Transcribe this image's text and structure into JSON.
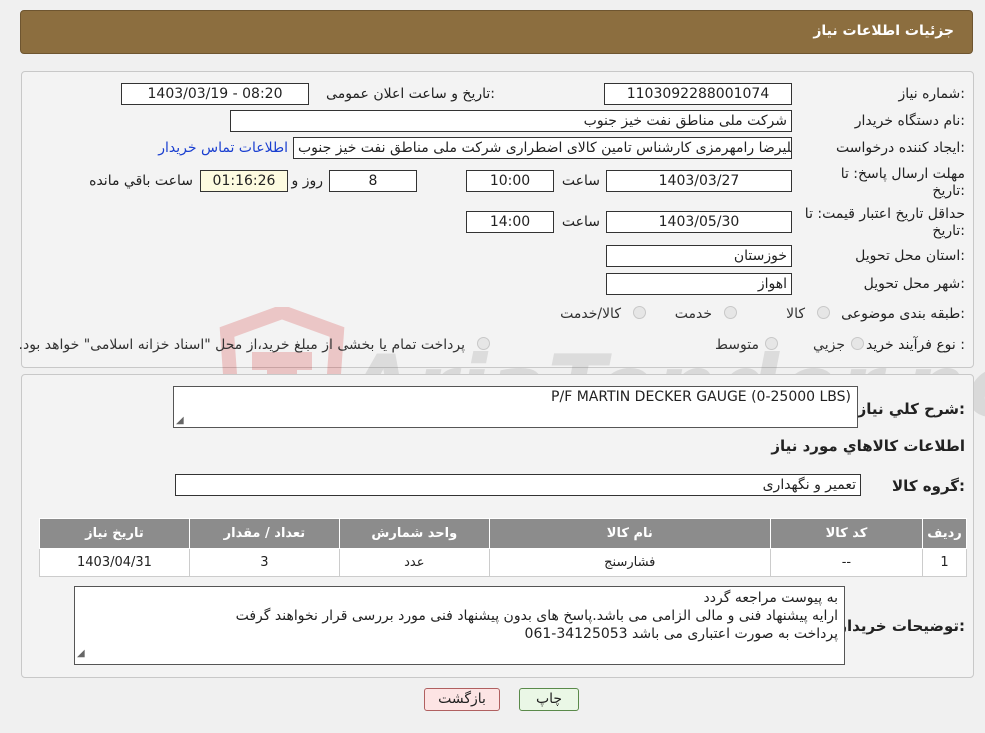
{
  "header": {
    "title": "جزئیات اطلاعات نیاز"
  },
  "form": {
    "need_number_label": "شماره نیاز:",
    "need_number": "1103092288001074",
    "announce_label": "تاریخ و ساعت اعلان عمومی:",
    "announce_value": "1403/03/19 - 08:20",
    "buyer_org_label": "نام دستگاه خریدار:",
    "buyer_org": "شرکت ملی مناطق نفت خیز جنوب",
    "creator_label": "ایجاد کننده درخواست:",
    "creator": "علیرضا رامهرمزی کارشناس تامین کالای اضطراری شرکت ملی مناطق نفت خیز جنوب",
    "contact_link": "اطلاعات تماس خریدار",
    "deadline_label_1": "مهلت ارسال پاسخ: تا",
    "deadline_label_2": "تاریخ:",
    "deadline_date": "1403/03/27",
    "time_label": "ساعت",
    "deadline_time": "10:00",
    "days_value": "8",
    "days_label": "روز و",
    "remaining_time": "01:16:26",
    "remaining_label": "ساعت باقي مانده",
    "validity_label_1": "حداقل تاریخ اعتبار قیمت: تا",
    "validity_label_2": "تاریخ:",
    "validity_date": "1403/05/30",
    "validity_time": "14:00",
    "province_label": "استان محل تحویل:",
    "province": "خوزستان",
    "city_label": "شهر محل تحویل:",
    "city": "اهواز",
    "category_label": "طبقه بندی موضوعی:",
    "category_options": [
      "کالا",
      "خدمت",
      "کالا/خدمت"
    ],
    "process_label": "نوع فرآیند خرید :",
    "process_options": [
      "جزیي",
      "متوسط"
    ],
    "process_note": "پرداخت تمام یا بخشی از مبلغ خرید،از محل \"اسناد خزانه اسلامی\" خواهد بود."
  },
  "details": {
    "summary_label": "شرح كلي نياز:",
    "summary": "P/F MARTIN DECKER GAUGE (0-25000 LBS)",
    "goods_info_title": "اطلاعات کالاهاي مورد نياز",
    "goods_group_label": "گروه کالا:",
    "goods_group": "تعمیر و نگهداری",
    "table": {
      "headers": [
        "ردیف",
        "کد کالا",
        "نام کالا",
        "واحد شمارش",
        "تعداد / مقدار",
        "تاریخ نیاز"
      ],
      "rows": [
        [
          "1",
          "--",
          "فشارسنج",
          "عدد",
          "3",
          "1403/04/31"
        ]
      ]
    },
    "buyer_notes_label": "توضیحات خریدار:",
    "buyer_notes": [
      "به پیوست مراجعه گردد",
      "ارایه پیشنهاد فنی و مالی الزامی می باشد.پاسخ های بدون پیشنهاد فنی مورد بررسی قرار نخواهند گرفت",
      "پرداخت به صورت اعتباری می باشد 34125053-061"
    ]
  },
  "buttons": {
    "print": "چاپ",
    "back": "بازگشت"
  },
  "colors": {
    "header": "#8c6e3f",
    "table_header": "#8c8c8c",
    "back_button": "#fde4e4",
    "print_button": "#eaf7e6"
  },
  "watermark": {
    "text": "AriaTender.neT"
  }
}
